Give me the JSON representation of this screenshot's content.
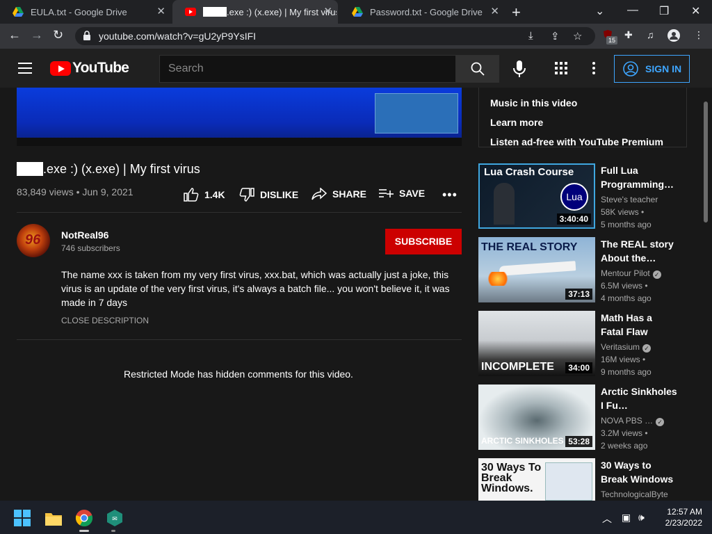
{
  "browser": {
    "tabs": [
      {
        "title": "EULA.txt - Google Drive",
        "icon": "google-drive-icon",
        "active": false
      },
      {
        "title": ".exe :) (x.exe) | My first virus",
        "icon": "youtube-icon",
        "active": true
      },
      {
        "title": "Password.txt - Google Drive",
        "icon": "google-drive-icon",
        "active": false
      }
    ],
    "url": "youtube.com/watch?v=gU2yP9YsIFI",
    "extension_badge": "15"
  },
  "youtube": {
    "logo_text": "YouTube",
    "search_placeholder": "Search",
    "sign_in_label": "SIGN IN"
  },
  "video": {
    "title": ".exe :) (x.exe) | My first virus",
    "views_date": "83,849 views • Jun 9, 2021",
    "like_count": "1.4K",
    "dislike_label": "DISLIKE",
    "share_label": "SHARE",
    "save_label": "SAVE",
    "channel_name": "NotReal96",
    "subscribers": "746 subscribers",
    "subscribe_label": "SUBSCRIBE",
    "description": "The name xxx is taken from my very first virus, xxx.bat, which was actually just a joke, this virus is an update of the very first virus, it's always a batch file... you won't believe it, it was made in 7 days",
    "close_description_label": "CLOSE DESCRIPTION",
    "comments_notice": "Restricted Mode has hidden comments for this video."
  },
  "music_box": {
    "items": [
      "Music in this video",
      "Learn more",
      "Listen ad-free with YouTube Premium"
    ]
  },
  "recommendations": [
    {
      "title": "Full Lua Programming…",
      "channel": "Steve's teacher",
      "views": "58K views •",
      "age": "5 months ago",
      "duration": "3:40:40",
      "verified": false,
      "thumb_text": "Lua Crash Course"
    },
    {
      "title": "The REAL story About the…",
      "channel": "Mentour Pilot",
      "views": "6.5M views •",
      "age": "4 months ago",
      "duration": "37:13",
      "verified": true,
      "thumb_text": "THE REAL STORY"
    },
    {
      "title": "Math Has a Fatal Flaw",
      "channel": "Veritasium",
      "views": "16M views •",
      "age": "9 months ago",
      "duration": "34:00",
      "verified": true,
      "thumb_text": "INCOMPLETE"
    },
    {
      "title": "Arctic Sinkholes I Fu…",
      "channel": "NOVA PBS …",
      "views": "3.2M views •",
      "age": "2 weeks ago",
      "duration": "53:28",
      "verified": true,
      "thumb_text": "ARCTIC SINKHOLES"
    },
    {
      "title": "30 Ways to Break Windows",
      "channel": "TechnologicalByte",
      "views": "",
      "age": "",
      "duration": "",
      "verified": false,
      "thumb_text": "30 Ways To Break Windows."
    }
  ],
  "taskbar": {
    "time": "12:57 AM",
    "date": "2/23/2022"
  }
}
